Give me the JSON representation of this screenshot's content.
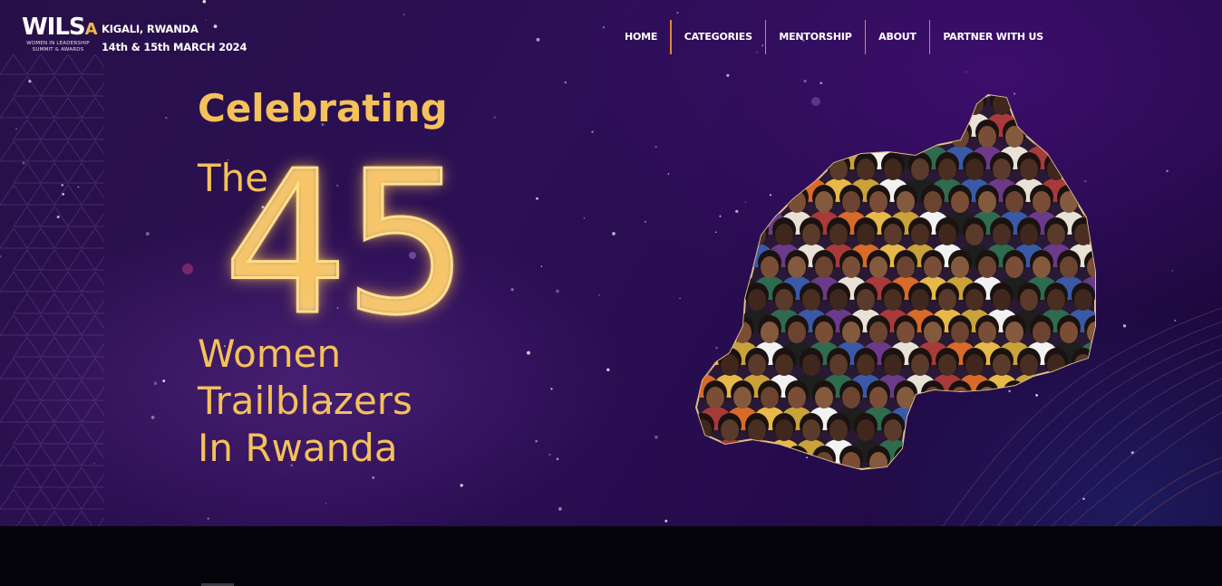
{
  "brand": {
    "logo_text": "WILS",
    "logo_accent": "A",
    "logo_subtitle_line1": "WOMEN IN LEADERSHIP",
    "logo_subtitle_line2": "SUMMIT & AWARDS",
    "location": "KIGALI, RWANDA",
    "dates": "14th & 15th MARCH 2024"
  },
  "nav": {
    "items": [
      {
        "label": "HOME"
      },
      {
        "label": "CATEGORIES"
      },
      {
        "label": "MENTORSHIP"
      },
      {
        "label": "ABOUT"
      },
      {
        "label": "PARTNER WITH US"
      }
    ]
  },
  "hero": {
    "line1": "Celebrating",
    "line2": "The",
    "number": "45",
    "line3": "Women",
    "line4": "Trailblazers",
    "line5": "In Rwanda"
  },
  "colors": {
    "accent_gold": "#f4c15a",
    "neon_gold": "#ffe08a",
    "nav_separator": "#d98a3a",
    "background_purple": "#2c0f55",
    "footer": "#05030a"
  }
}
